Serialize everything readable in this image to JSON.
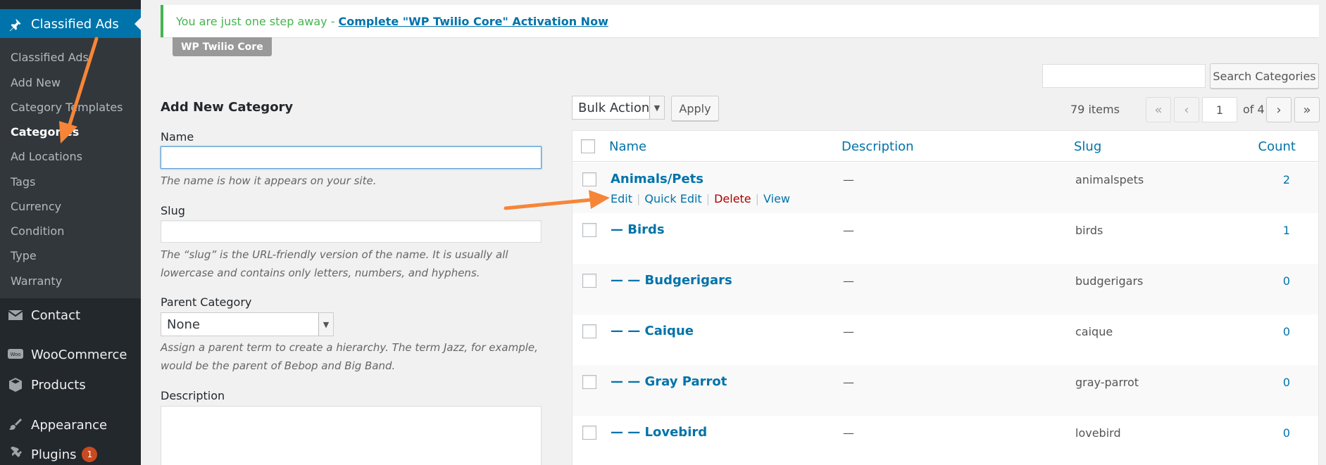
{
  "sidebar": {
    "top_item": "Classified Ads",
    "submenu": [
      "Classified Ads",
      "Add New",
      "Category Templates",
      "Categories",
      "Ad Locations",
      "Tags",
      "Currency",
      "Condition",
      "Type",
      "Warranty"
    ],
    "menu": [
      {
        "label": "Contact",
        "icon": "mail-icon"
      },
      {
        "label": "WooCommerce",
        "icon": "woocommerce-icon"
      },
      {
        "label": "Products",
        "icon": "products-box-icon"
      },
      {
        "label": "Appearance",
        "icon": "brush-icon"
      },
      {
        "label": "Plugins",
        "icon": "plugin-icon",
        "badge": "1"
      }
    ]
  },
  "notice": {
    "text": "You are just one step away -",
    "link": "Complete \"WP Twilio Core\" Activation Now",
    "tag": "WP Twilio Core"
  },
  "form": {
    "title": "Add New Category",
    "name_label": "Name",
    "name_value": "",
    "name_desc": "The name is how it appears on your site.",
    "slug_label": "Slug",
    "slug_value": "",
    "slug_desc": "The “slug” is the URL-friendly version of the name. It is usually all lowercase and contains only letters, numbers, and hyphens.",
    "parent_label": "Parent Category",
    "parent_value": "None",
    "parent_desc": "Assign a parent term to create a hierarchy. The term Jazz, for example, would be the parent of Bebop and Big Band.",
    "description_label": "Description"
  },
  "toolbar": {
    "search_button": "Search Categories",
    "search_value": "",
    "bulk_actions": "Bulk Actions",
    "apply": "Apply",
    "items_count": "79 items",
    "first": "«",
    "prev": "‹",
    "page": "1",
    "of_pages": "of 4",
    "next": "›",
    "last": "»"
  },
  "table": {
    "columns": {
      "name": "Name",
      "description": "Description",
      "slug": "Slug",
      "count": "Count"
    },
    "row_actions": {
      "edit": "Edit",
      "quick_edit": "Quick Edit",
      "delete": "Delete",
      "view": "View",
      "separator": "|"
    },
    "rows": [
      {
        "name": "Animals/Pets",
        "description": "—",
        "slug": "animalspets",
        "count": "2"
      },
      {
        "name": "— Birds",
        "description": "—",
        "slug": "birds",
        "count": "1"
      },
      {
        "name": "— — Budgerigars",
        "description": "—",
        "slug": "budgerigars",
        "count": "0"
      },
      {
        "name": "— — Caique",
        "description": "—",
        "slug": "caique",
        "count": "0"
      },
      {
        "name": "— — Gray Parrot",
        "description": "—",
        "slug": "gray-parrot",
        "count": "0"
      },
      {
        "name": "— — Lovebird",
        "description": "—",
        "slug": "lovebird",
        "count": "0"
      }
    ]
  },
  "colors": {
    "primary": "#0073aa",
    "sidebar": "#23282d",
    "arrow": "#f78538",
    "notice": "#46b450"
  }
}
